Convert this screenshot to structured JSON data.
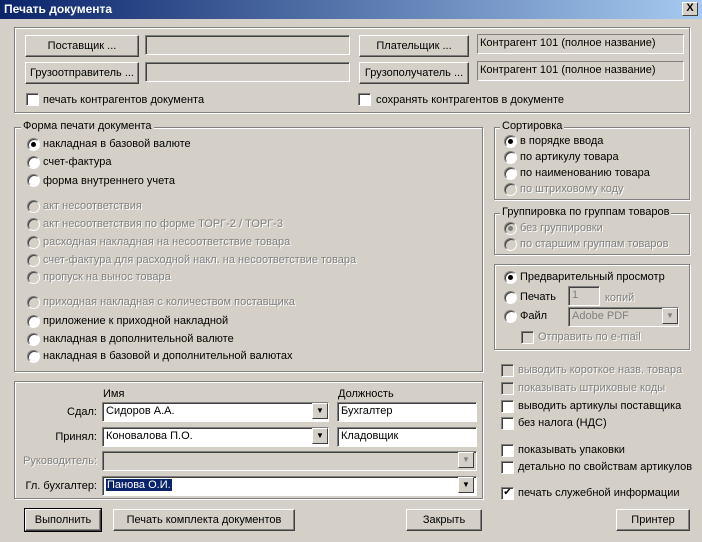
{
  "window": {
    "title": "Печать документа",
    "close": "X"
  },
  "parties": {
    "supplier_btn": "Поставщик ...",
    "payer_btn": "Плательщик ...",
    "shipper_btn": "Грузоотправитель ...",
    "consignee_btn": "Грузополучатель ...",
    "supplier_value": "",
    "shipper_value": "",
    "payer_value": "Контрагент 101 (полное название)",
    "consignee_value": "Контрагент 101 (полное название)",
    "print_parties": "печать контрагентов документа",
    "save_parties": "сохранять контрагентов в документе"
  },
  "print_form": {
    "legend": "Форма печати документа",
    "options": [
      "накладная в базовой валюте",
      "счет-фактура",
      "форма внутреннего учета",
      "акт несоответствия",
      "акт несоответствия по форме ТОРГ-2 / ТОРГ-3",
      "расходная накладная на несоответствие товара",
      "счет-фактура для расходной накл. на несоответствие товара",
      "пропуск на вынос товара",
      "приходная накладная с количеством поставщика",
      "приложение к приходной накладной",
      "накладная в дополнительной валюте",
      "накладная в базовой и дополнительной валютах"
    ],
    "selected": 0
  },
  "sort": {
    "legend": "Сортировка",
    "options": [
      "в порядке ввода",
      "по артикулу товара",
      "по наименованию товара",
      "по штриховому коду"
    ],
    "selected": 0
  },
  "grouping": {
    "legend": "Группировка по группам товаров",
    "options": [
      "без группировки",
      "по старшим группам товаров"
    ],
    "selected": 0
  },
  "output": {
    "preview": "Предварительный просмотр",
    "print": "Печать",
    "copies": "1",
    "copies_label": "копий",
    "file": "Файл",
    "file_format": "Adobe PDF",
    "send_email": "Отправить по e-mail"
  },
  "options": {
    "short_name": "выводить короткое назв. товара",
    "barcodes": "показывать штриховые коды",
    "supplier_articles": "выводить артикулы поставщика",
    "no_vat": "без налога (НДС)",
    "show_packs": "показывать упаковки",
    "by_article_props": "детально по свойствам артикулов",
    "print_service_info": "печать служебной информации"
  },
  "signatures": {
    "name_header": "Имя",
    "position_header": "Должность",
    "rows": [
      {
        "label": "Сдал:",
        "name": "Сидоров А.А.",
        "position": "Бухгалтер"
      },
      {
        "label": "Принял:",
        "name": "Коновалова П.О.",
        "position": "Кладовщик"
      },
      {
        "label": "Руководитель:",
        "name": "",
        "position": ""
      },
      {
        "label": "Гл. бухгалтер:",
        "name": "Панова О.И.",
        "position": ""
      }
    ]
  },
  "buttons": {
    "execute": "Выполнить",
    "print_set": "Печать комплекта документов",
    "close": "Закрыть",
    "printer": "Принтер"
  },
  "icons": {
    "dropdown": "▼",
    "check": "✔"
  }
}
